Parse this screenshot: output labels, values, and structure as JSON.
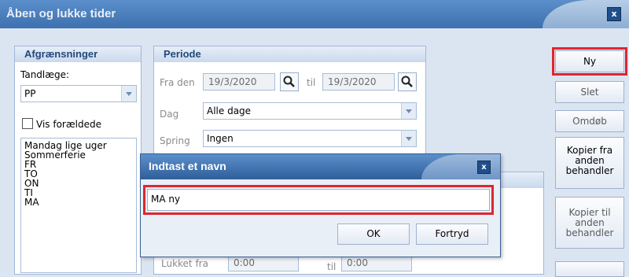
{
  "window": {
    "title": "Åben og lukke tider",
    "close_label": "x"
  },
  "afgraensninger": {
    "header": "Afgrænsninger",
    "tandlaege_label": "Tandlæge:",
    "tandlaege_value": "PP",
    "vis_foraeldede_label": "Vis forældede",
    "items": [
      "Mandag lige uger",
      "Sommerferie",
      "FR",
      "TO",
      "ON",
      "TI",
      "MA"
    ]
  },
  "periode": {
    "header": "Periode",
    "fra_den_label": "Fra den",
    "fra_den_value": "19/3/2020",
    "til_label": "til",
    "til_value": "19/3/2020",
    "dag_label": "Dag",
    "dag_value": "Alle dage",
    "spring_label": "Spring",
    "spring_value": "Ingen",
    "lukket_fra_label": "Lukket fra",
    "lukket_fra_value": "0:00",
    "lukket_til_label": "til",
    "lukket_til_value": "0:00"
  },
  "buttons": {
    "ny": "Ny",
    "slet": "Slet",
    "omdoeb": "Omdøb",
    "kopier_fra": [
      "Kopier fra",
      "anden",
      "behandler"
    ],
    "kopier_til": [
      "Kopier til",
      "anden",
      "behandler"
    ]
  },
  "dialog": {
    "title": "Indtast et navn",
    "close_label": "x",
    "input_value": "MA ny",
    "ok_label": "OK",
    "cancel_label": "Fortryd"
  },
  "colors": {
    "highlight": "#e0262e",
    "titlebar": "#3d70ae",
    "header_text": "#24487a"
  }
}
